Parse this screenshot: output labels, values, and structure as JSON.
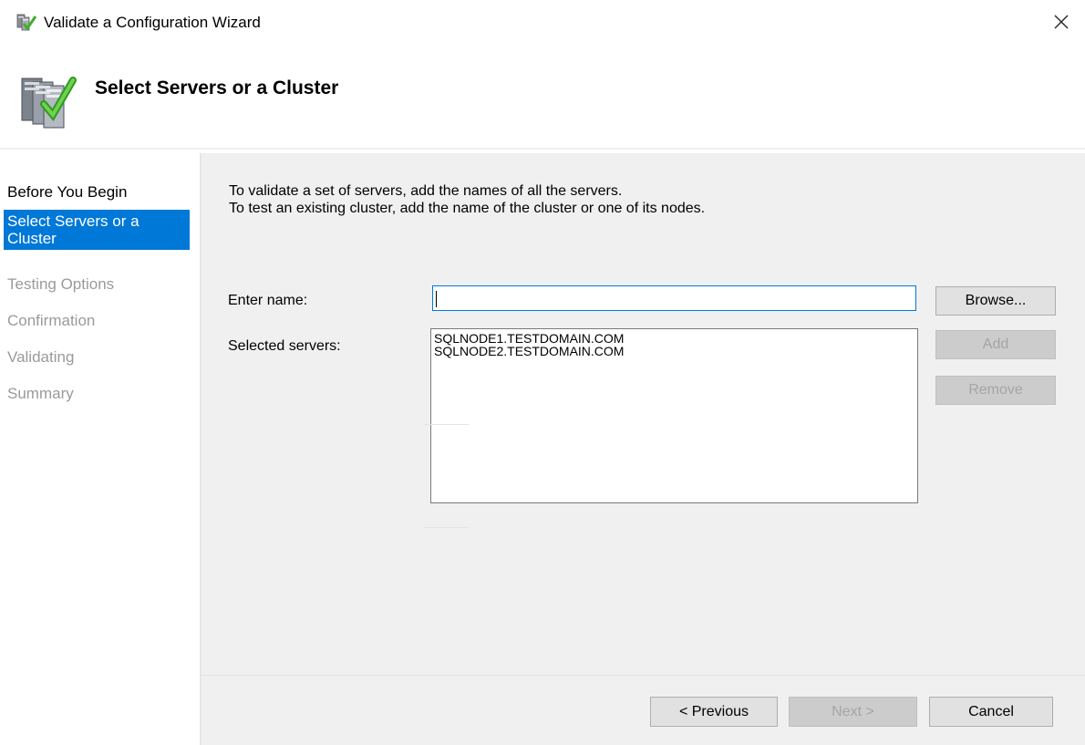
{
  "window": {
    "title": "Validate a Configuration Wizard",
    "icon": "cluster-wizard-icon",
    "close_icon": "close-icon"
  },
  "header": {
    "title": "Select Servers or a Cluster",
    "icon": "server-checkmark-icon"
  },
  "nav": {
    "items": [
      {
        "label": "Before You Begin",
        "state": "completed"
      },
      {
        "label": "Select Servers or a Cluster",
        "state": "current"
      },
      {
        "label": "Testing Options",
        "state": "pending"
      },
      {
        "label": "Confirmation",
        "state": "pending"
      },
      {
        "label": "Validating",
        "state": "pending"
      },
      {
        "label": "Summary",
        "state": "pending"
      }
    ]
  },
  "main": {
    "intro_line1": "To validate a set of servers, add the names of all the servers.",
    "intro_line2": "To test an existing cluster, add the name of the cluster or one of its nodes.",
    "enter_name_label": "Enter name:",
    "enter_name_value": "",
    "selected_servers_label": "Selected servers:",
    "selected_servers": [
      "SQLNODE1.TESTDOMAIN.COM",
      "SQLNODE2.TESTDOMAIN.COM"
    ],
    "browse_label": "Browse...",
    "add_label": "Add",
    "remove_label": "Remove"
  },
  "footer": {
    "previous_label": "< Previous",
    "next_label": "Next >",
    "cancel_label": "Cancel"
  },
  "colors": {
    "accent": "#0078d7",
    "panel_bg": "#f0f0f0",
    "disabled_text": "#a5a5a5"
  }
}
